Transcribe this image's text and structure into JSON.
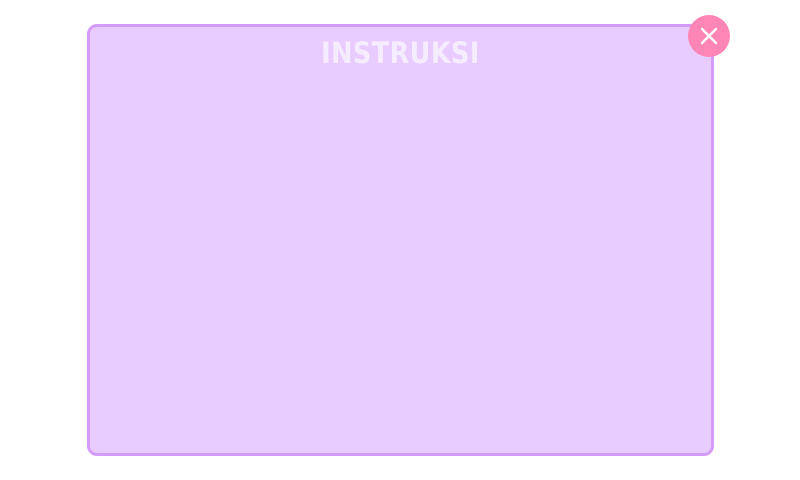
{
  "dialog": {
    "title": "INSTRUKSI",
    "body_text": ""
  },
  "close_button": {
    "icon": "close-icon"
  },
  "colors": {
    "page_background": "#ffffff",
    "modal_background": "#e8ccff",
    "modal_border": "#d49cf7",
    "title_text": "#f6ecff",
    "close_button_background": "#fd86b6",
    "close_icon": "#ffffff"
  }
}
